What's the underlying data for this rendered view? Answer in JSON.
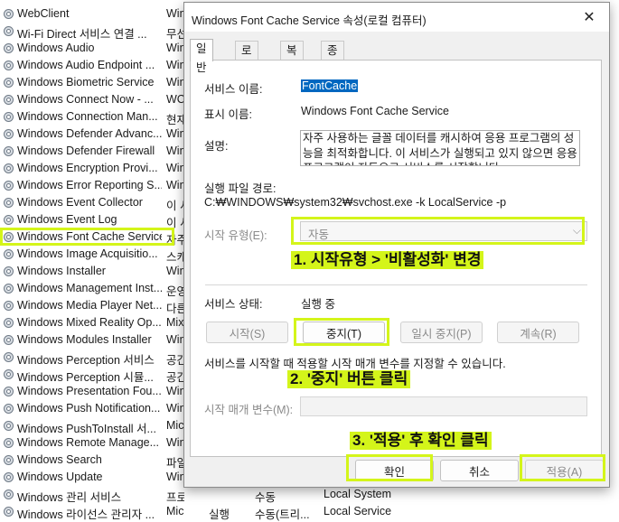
{
  "services": [
    {
      "name": "WebClient",
      "desc": "Win",
      "status": "",
      "type": "",
      "logon": ""
    },
    {
      "name": "Wi-Fi Direct 서비스 연결 ...",
      "desc": "무선",
      "status": "",
      "type": "",
      "logon": ""
    },
    {
      "name": "Windows Audio",
      "desc": "Win",
      "status": "",
      "type": "",
      "logon": ""
    },
    {
      "name": "Windows Audio Endpoint ...",
      "desc": "Win",
      "status": "",
      "type": "",
      "logon": ""
    },
    {
      "name": "Windows Biometric Service",
      "desc": "Win",
      "status": "",
      "type": "",
      "logon": ""
    },
    {
      "name": "Windows Connect Now - ...",
      "desc": "WC",
      "status": "",
      "type": "",
      "logon": ""
    },
    {
      "name": "Windows Connection Man...",
      "desc": "현재",
      "status": "",
      "type": "",
      "logon": ""
    },
    {
      "name": "Windows Defender Advanc...",
      "desc": "Win",
      "status": "",
      "type": "",
      "logon": ""
    },
    {
      "name": "Windows Defender Firewall",
      "desc": "Win",
      "status": "",
      "type": "",
      "logon": ""
    },
    {
      "name": "Windows Encryption Provi...",
      "desc": "Win",
      "status": "",
      "type": "",
      "logon": ""
    },
    {
      "name": "Windows Error Reporting S...",
      "desc": "Win",
      "status": "",
      "type": "",
      "logon": ""
    },
    {
      "name": "Windows Event Collector",
      "desc": "이 서",
      "status": "",
      "type": "",
      "logon": ""
    },
    {
      "name": "Windows Event Log",
      "desc": "이 서",
      "status": "",
      "type": "",
      "logon": ""
    },
    {
      "name": "Windows Font Cache Service",
      "desc": "자주",
      "status": "",
      "type": "",
      "logon": ""
    },
    {
      "name": "Windows Image Acquisitio...",
      "desc": "스캐",
      "status": "",
      "type": "",
      "logon": ""
    },
    {
      "name": "Windows Installer",
      "desc": "Win",
      "status": "",
      "type": "",
      "logon": ""
    },
    {
      "name": "Windows Management Inst...",
      "desc": "운영",
      "status": "",
      "type": "",
      "logon": ""
    },
    {
      "name": "Windows Media Player Net...",
      "desc": "다른",
      "status": "",
      "type": "",
      "logon": ""
    },
    {
      "name": "Windows Mixed Reality Op...",
      "desc": "Mix",
      "status": "",
      "type": "",
      "logon": ""
    },
    {
      "name": "Windows Modules Installer",
      "desc": "Win",
      "status": "",
      "type": "",
      "logon": ""
    },
    {
      "name": "Windows Perception 서비스",
      "desc": "공간",
      "status": "",
      "type": "",
      "logon": ""
    },
    {
      "name": "Windows Perception 시뮬...",
      "desc": "공간",
      "status": "",
      "type": "",
      "logon": ""
    },
    {
      "name": "Windows Presentation Fou...",
      "desc": "Win",
      "status": "",
      "type": "",
      "logon": ""
    },
    {
      "name": "Windows Push Notification...",
      "desc": "Win",
      "status": "",
      "type": "",
      "logon": ""
    },
    {
      "name": "Windows PushToInstall 서...",
      "desc": "Mic",
      "status": "",
      "type": "",
      "logon": ""
    },
    {
      "name": "Windows Remote Manage...",
      "desc": "Win",
      "status": "",
      "type": "",
      "logon": ""
    },
    {
      "name": "Windows Search",
      "desc": "파일",
      "status": "",
      "type": "",
      "logon": ""
    },
    {
      "name": "Windows Update",
      "desc": "Win",
      "status": "",
      "type": "",
      "logon": ""
    },
    {
      "name": "Windows 관리 서비스",
      "desc": "프로...",
      "status": "",
      "type": "수동",
      "logon": "Local System"
    },
    {
      "name": "Windows 라이선스 관리자 ...",
      "desc": "Micr...",
      "status": "실행",
      "type": "수동(트리...",
      "logon": "Local Service"
    }
  ],
  "dialog": {
    "title": "Windows Font Cache Service 속성(로컬 컴퓨터)",
    "close": "✕",
    "tabs": [
      "일반",
      "로그온",
      "복구",
      "종속성"
    ],
    "service_name_label": "서비스 이름:",
    "service_name": "FontCache",
    "display_name_label": "표시 이름:",
    "display_name": "Windows Font Cache Service",
    "description_label": "설명:",
    "description": "자주 사용하는 글꼴 데이터를 캐시하여 응용 프로그램의 성능을 최적화합니다. 이 서비스가 실행되고 있지 않으면 응용 프로그램이 자동으로 서비스를 시작합니다.",
    "exe_path_label": "실행 파일 경로:",
    "exe_path": "C:₩WINDOWS₩system32₩svchost.exe -k LocalService -p",
    "startup_type_label": "시작 유형(E):",
    "startup_type": "자동",
    "startup_chevron": "⌵",
    "service_status_label": "서비스 상태:",
    "service_status": "실행 중",
    "buttons": {
      "start": "시작(S)",
      "stop": "중지(T)",
      "pause": "일시 중지(P)",
      "resume": "계속(R)"
    },
    "params_note": "서비스를 시작할 때 적용할 시작 매개 변수를 지정할 수 있습니다.",
    "params_label": "시작 매개 변수(M):",
    "ok": "확인",
    "cancel": "취소",
    "apply": "적용(A)"
  },
  "annotations": {
    "step1": "1. 시작유형 > '비활성화' 변경",
    "step2": "2. '중지' 버튼 클릭",
    "step3": "3. '적용' 후 확인 클릭"
  },
  "colors": {
    "highlight": "#d4f51a",
    "selection": "#0067c0"
  }
}
